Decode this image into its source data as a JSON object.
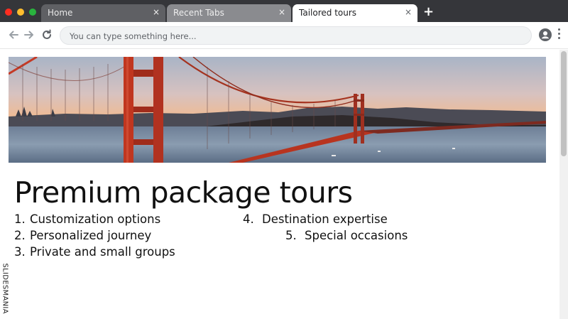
{
  "browser": {
    "tabs": [
      {
        "label": "Home",
        "close": "×",
        "state": "inactive"
      },
      {
        "label": "Recent Tabs",
        "close": "×",
        "state": "inactive"
      },
      {
        "label": "Tailored tours",
        "close": "×",
        "state": "active"
      }
    ],
    "new_tab": "+",
    "address_bar": {
      "value": "",
      "placeholder": "You can type something here..."
    },
    "icons": [
      "back-arrow-icon",
      "forward-arrow-icon",
      "reload-icon",
      "profile-icon",
      "more-menu-icon"
    ],
    "colors": {
      "titlebar": "#35363a",
      "close_dot": "#ff2d20",
      "minimize_dot": "#ffbd2e",
      "maximize_dot": "#27c93f"
    }
  },
  "slide": {
    "title": "Premium package tours",
    "items": [
      {
        "number": "1.",
        "text": "Customization options"
      },
      {
        "number": "2.",
        "text": "Personalized journey"
      },
      {
        "number": "3.",
        "text": "Private and small groups"
      },
      {
        "number": "4.",
        "text": "Destination expertise"
      },
      {
        "number": "5.",
        "text": "Special occasions"
      }
    ],
    "watermark": "SLIDESMANIA",
    "hero_image": "golden-gate-bridge-sunset"
  }
}
